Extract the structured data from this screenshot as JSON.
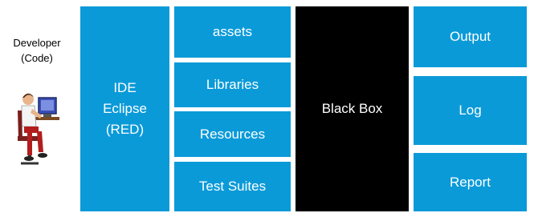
{
  "developer": {
    "label": "Developer\n(Code)",
    "icon": "developer-at-computer-icon"
  },
  "ide": {
    "label": "IDE\nEclipse\n(RED)"
  },
  "components": [
    {
      "label": "assets"
    },
    {
      "label": "Libraries"
    },
    {
      "label": "Resources"
    },
    {
      "label": "Test Suites"
    }
  ],
  "black_box": {
    "label": "Black Box"
  },
  "outputs": [
    {
      "label": "Output"
    },
    {
      "label": "Log"
    },
    {
      "label": "Report"
    }
  ],
  "colors": {
    "blue": "#0b9ad8",
    "black": "#000000",
    "text_on_box": "#ffffff"
  }
}
